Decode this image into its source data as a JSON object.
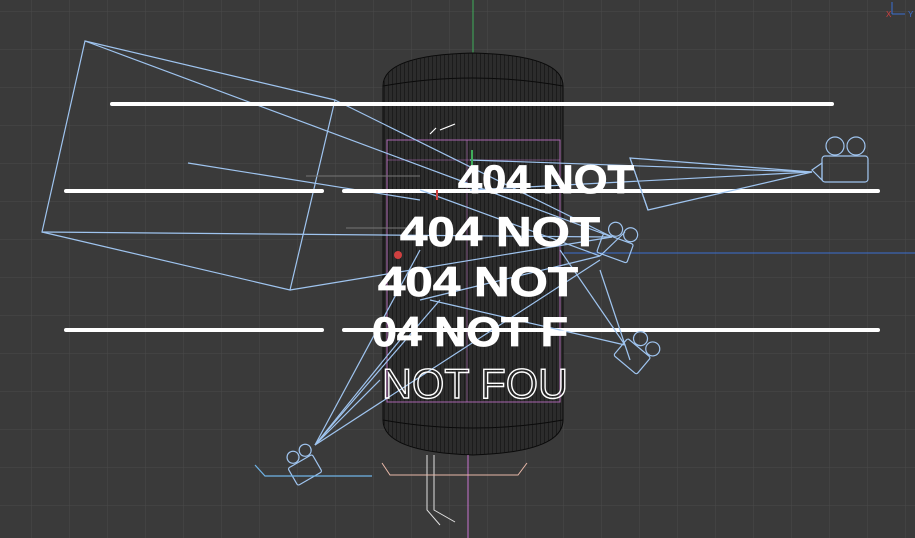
{
  "viewport": {
    "background": "#3a3a3a",
    "grid_color": "#4a4a4a",
    "wire_color": "#9fc4ef",
    "mesh_color": "#1a1a1a",
    "accent_magenta": "#c874d0"
  },
  "text_layers": [
    {
      "text": "404 NOT"
    },
    {
      "text": "404 NOT"
    },
    {
      "text": "404 NOT"
    },
    {
      "text": "04 NOT F"
    },
    {
      "text": "NOT FOU"
    }
  ],
  "axis_gizmo": {
    "x_label": "X",
    "y_label": "Y"
  },
  "icons": [
    "camera-icon",
    "camera-icon",
    "camera-icon",
    "camera-icon",
    "axis-gizmo-icon"
  ]
}
